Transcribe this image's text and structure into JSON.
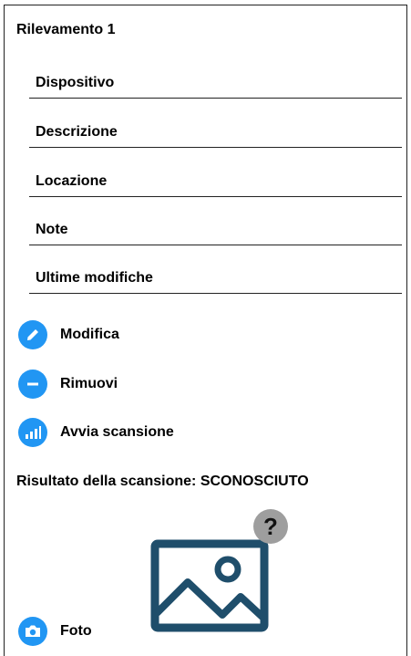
{
  "title": "Rilevamento 1",
  "fields": [
    {
      "label": "Dispositivo"
    },
    {
      "label": "Descrizione"
    },
    {
      "label": "Locazione"
    },
    {
      "label": "Note"
    },
    {
      "label": "Ultime modifiche"
    }
  ],
  "actions": {
    "edit": {
      "label": "Modifica",
      "icon": "pencil-icon"
    },
    "remove": {
      "label": "Rimuovi",
      "icon": "minus-icon"
    },
    "scan": {
      "label": "Avvia scansione",
      "icon": "signal-bars-icon"
    },
    "photo": {
      "label": "Foto",
      "icon": "camera-icon"
    }
  },
  "scan_result": "Risultato della scansione: SCONOSCIUTO",
  "unknown_badge": "?",
  "colors": {
    "accent": "#2196f3",
    "image_icon": "#1f4e6b",
    "badge": "#9e9e9e"
  }
}
